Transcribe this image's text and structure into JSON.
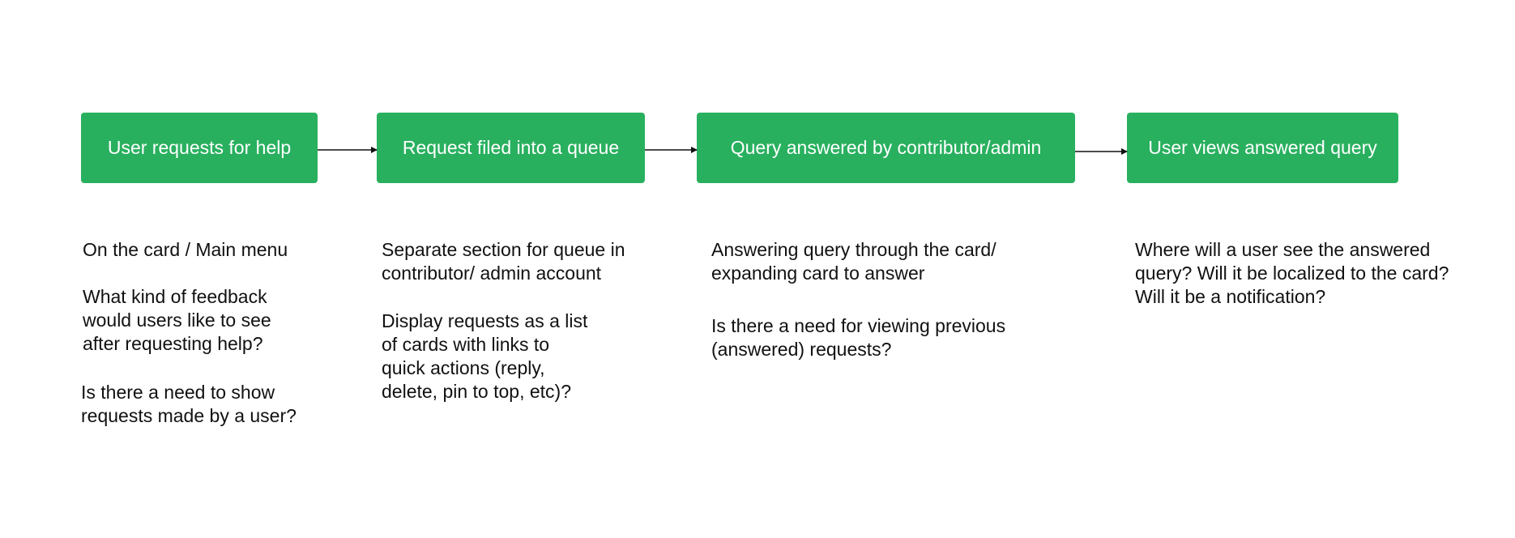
{
  "steps": [
    {
      "label": "User requests for help"
    },
    {
      "label": "Request filed into a queue"
    },
    {
      "label": "Query answered by contributor/admin"
    },
    {
      "label": "User views answered query"
    }
  ],
  "notes": {
    "step1": [
      "On the card / Main menu",
      "What kind of feedback\nwould users like to see\nafter requesting help?",
      "Is there a need to show\nrequests made by a user?"
    ],
    "step2": [
      "Separate section for queue in\ncontributor/ admin account",
      "Display requests as a list\nof  cards with links to\nquick actions (reply,\ndelete, pin to top, etc)?"
    ],
    "step3": [
      "Answering query through the card/\nexpanding card to answer",
      "Is there a need for viewing previous\n(answered) requests?"
    ],
    "step4": [
      "Where will a user see the answered\nquery? Will it be localized to the card?\nWill it be a notification?"
    ]
  },
  "colors": {
    "box_fill": "#29b05f",
    "box_text": "#ffffff",
    "arrow": "#111111",
    "note_text": "#111111"
  }
}
